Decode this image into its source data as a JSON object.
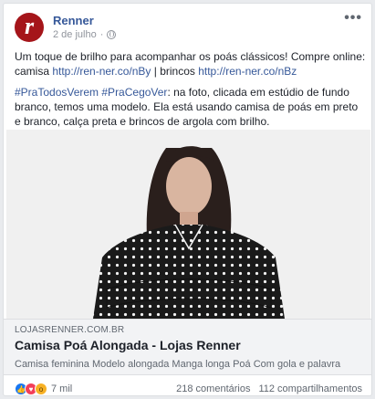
{
  "post": {
    "page_name": "Renner",
    "avatar_letter": "r",
    "date": "2 de julho",
    "date_separator": "·",
    "more": "•••",
    "text_line1": "Um toque de brilho para acompanhar os poás clássicos! Compre online: camisa ",
    "link1": "http://ren-ner.co/nBy",
    "text_mid": " | brincos ",
    "link2": "http://ren-ner.co/nBz",
    "hashtags": "#PraTodosVerem #PraCegoVer",
    "description": ": na foto, clicada em estúdio de fundo branco, temos uma modelo. Ela está usando camisa de poás em preto e branco, calça preta e brincos de argola com brilho."
  },
  "link_preview": {
    "domain": "LOJASRENNER.COM.BR",
    "title": "Camisa Poá Alongada - Lojas Renner",
    "description": "Camisa feminina  Modelo alongada Manga longa  Poá Com gola e palavra"
  },
  "stats": {
    "reactions_count": "7 mil",
    "comments": "218 comentários",
    "shares": "112 compartilhamentos"
  },
  "icons": {
    "like": "like-icon",
    "love": "love-icon",
    "wow": "wow-icon"
  },
  "colors": {
    "brand": "#a5151a",
    "link": "#365899"
  }
}
